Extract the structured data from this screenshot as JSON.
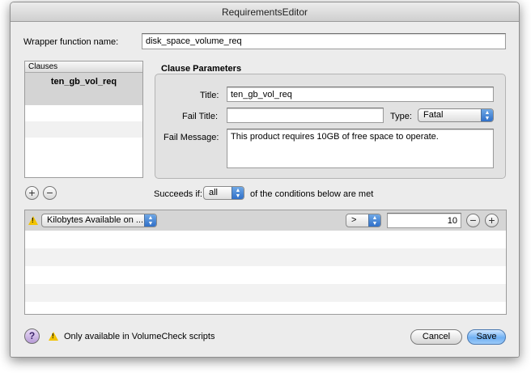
{
  "window": {
    "title": "RequirementsEditor"
  },
  "wrapper": {
    "label": "Wrapper function name:",
    "value": "disk_space_volume_req"
  },
  "clauses": {
    "header": "Clauses",
    "items": [
      {
        "label": "ten_gb_vol_req",
        "selected": true
      }
    ],
    "add_symbol": "+",
    "remove_symbol": "−"
  },
  "params": {
    "group_title": "Clause Parameters",
    "title_label": "Title:",
    "title_value": "ten_gb_vol_req",
    "fail_title_label": "Fail Title:",
    "fail_title_value": "",
    "type_label": "Type:",
    "type_value": "Fatal",
    "fail_message_label": "Fail Message:",
    "fail_message_value": "This product requires 10GB of free space to operate."
  },
  "succeeds": {
    "prefix": "Succeeds if:",
    "selected": "all",
    "suffix": "of the conditions below are met"
  },
  "condition": {
    "field": "Kilobytes Available on ...",
    "operator": ">",
    "value": "10",
    "add_symbol": "+",
    "remove_symbol": "−",
    "warning_icon": "warning-icon"
  },
  "footer": {
    "help_symbol": "?",
    "note": "Only available in VolumeCheck scripts",
    "cancel_label": "Cancel",
    "save_label": "Save"
  },
  "colors": {
    "accent": "#6fb0f3",
    "warning": "#f2c300",
    "selection": "#d4d4d4"
  }
}
